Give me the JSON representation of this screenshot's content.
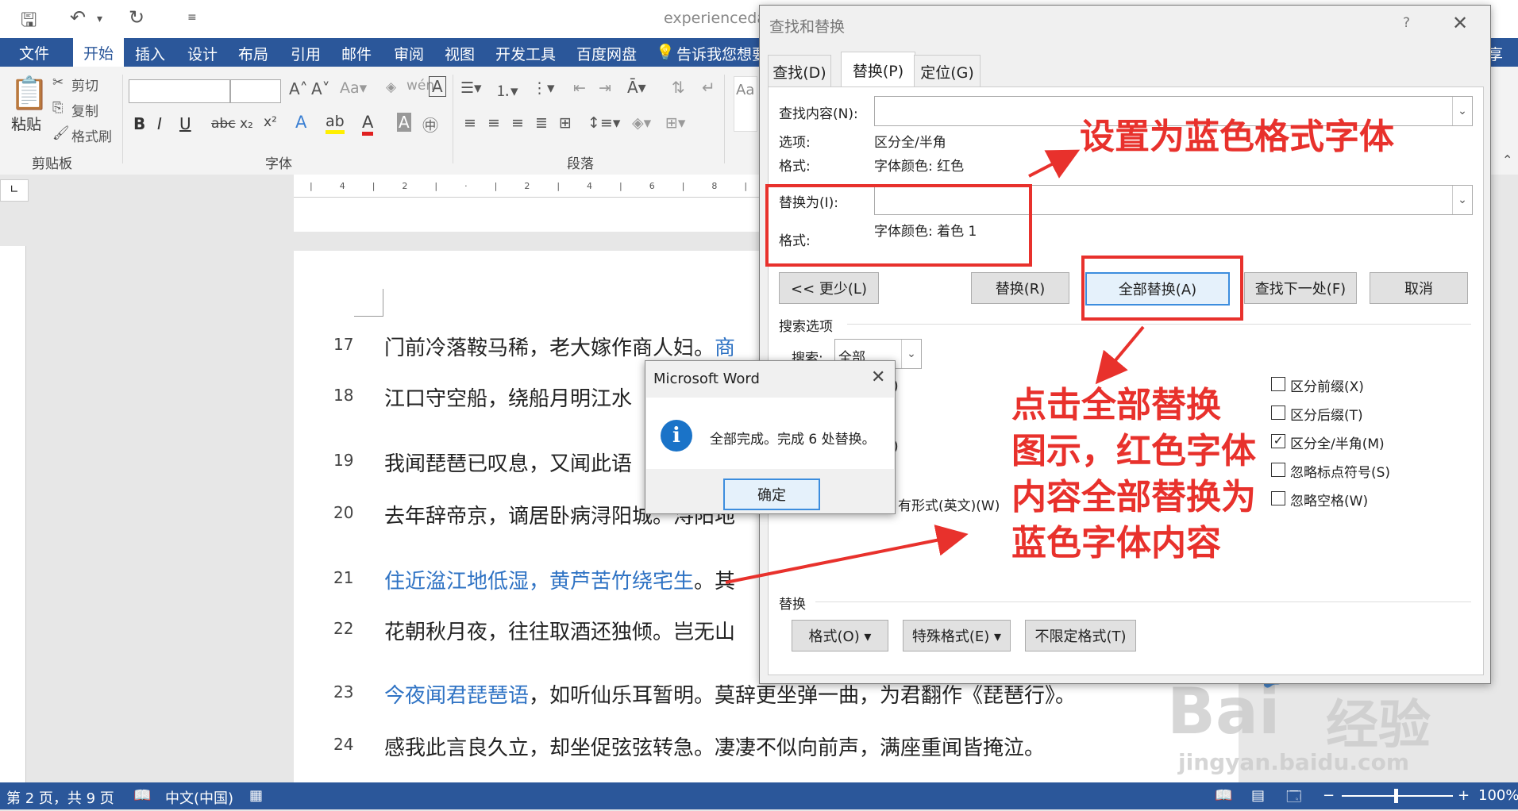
{
  "window": {
    "doc_title": "experiencedat"
  },
  "ribbon_tabs": {
    "file": "文件",
    "home": "开始",
    "insert": "插入",
    "design": "设计",
    "layout": "布局",
    "references": "引用",
    "mailings": "邮件",
    "review": "审阅",
    "view": "视图",
    "developer": "开发工具",
    "baidu": "百度网盘",
    "tell_me": "告诉我您想要"
  },
  "share_fragment": "享",
  "clipboard": {
    "paste": "粘贴",
    "cut": "剪切",
    "copy": "复制",
    "format_painter": "格式刷",
    "group": "剪贴板"
  },
  "font_group": {
    "label": "字体"
  },
  "paragraph_group": {
    "label": "段落"
  },
  "styles_fragment": "Aa",
  "doc_lines": [
    {
      "num": "17",
      "segments": [
        "门前冷落鞍马稀，老大嫁作商人妇。",
        "商"
      ]
    },
    {
      "num": "18",
      "segments": [
        "江口守空船，绕船月明江水"
      ]
    },
    {
      "num": "19",
      "segments": [
        "我闻琵琶已叹息，又闻此语"
      ]
    },
    {
      "num": "20",
      "segments": [
        "去年辞帝京，谪居卧病浔阳城。浔阳地"
      ]
    },
    {
      "num": "21",
      "segments": [
        "住近湓江地低湿，",
        "黄芦苦竹绕宅生",
        "。其"
      ]
    },
    {
      "num": "22",
      "segments": [
        "花朝秋月夜，往往取酒还独倾。岂无山"
      ]
    },
    {
      "num": "23",
      "segments": [
        "今夜闻君琵琶语",
        "，如听仙乐耳暂明。莫辞更坐弹一曲，为君翻作《琵琶行》。"
      ]
    },
    {
      "num": "24",
      "segments": [
        "感我此言良久立，却坐促弦弦转急。凄凄不似向前声，满座重闻皆掩泣。"
      ]
    }
  ],
  "status_bar": {
    "page": "第 2 页，共 9 页",
    "language": "中文(中国)",
    "zoom": "100%"
  },
  "find_replace": {
    "title": "查找和替换",
    "help": "?",
    "tabs": [
      "查找(D)",
      "替换(P)",
      "定位(G)"
    ],
    "find_label": "查找内容(N):",
    "options_label": "选项:",
    "options_value": "区分全/半角",
    "format_label": "格式:",
    "find_format_value": "字体颜色: 红色",
    "replace_label": "替换为(I):",
    "replace_format_label": "格式:",
    "replace_format_value": "字体颜色: 着色 1",
    "less_button": "<< 更少(L)",
    "replace_button": "替换(R)",
    "replace_all_button": "全部替换(A)",
    "find_next_button": "查找下一处(F)",
    "cancel_button": "取消",
    "search_options": "搜索选项",
    "search_label": "搜索:",
    "search_value": "全部",
    "partial_1": ")",
    "partial_2": ")",
    "partial_3": "有形式(英文)(W)",
    "checkboxes": [
      {
        "label": "区分前缀(X)",
        "checked": false
      },
      {
        "label": "区分后缀(T)",
        "checked": false
      },
      {
        "label": "区分全/半角(M)",
        "checked": true
      },
      {
        "label": "忽略标点符号(S)",
        "checked": false
      },
      {
        "label": "忽略空格(W)",
        "checked": false
      }
    ],
    "replace_section": "替换",
    "format_button": "格式(O) ▾",
    "special_button": "特殊格式(E) ▾",
    "no_format_button": "不限定格式(T)"
  },
  "message_box": {
    "title": "Microsoft Word",
    "message": "全部完成。完成 6 处替换。",
    "ok": "确定"
  },
  "annotations": {
    "set_blue": "设置为蓝色格式字体",
    "click_lines": [
      "点击全部替换",
      "图示，红色字体",
      "内容全部替换为",
      "蓝色字体内容"
    ]
  },
  "watermark": {
    "brand": "Bai",
    "brand2": "经验",
    "url": "jingyan.baidu.com"
  },
  "colors": {
    "word_blue": "#2b579a",
    "replaced_text": "#2f73c4",
    "annotation_red": "#e8312c"
  }
}
